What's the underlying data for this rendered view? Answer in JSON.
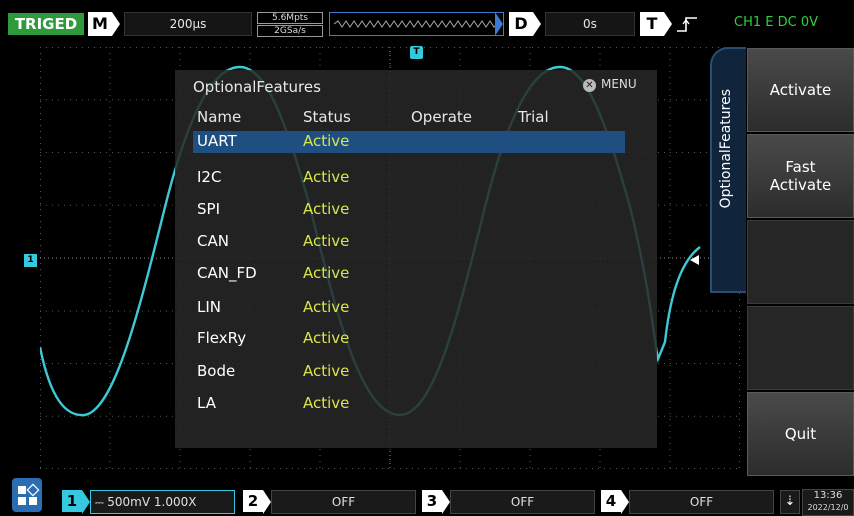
{
  "topbar": {
    "trigger_status": "TRIGED",
    "mode_key": "M",
    "timebase": "200µs",
    "memory_depth": "5.6Mpts",
    "sample_rate": "2GSa/s",
    "delay_key": "D",
    "delay_value": "0s",
    "trigger_key": "T",
    "trigger_info": "CH1 E DC 0V"
  },
  "markers": {
    "trigger_top": "T",
    "ch1_level": "1"
  },
  "dialog": {
    "title": "OptionalFeatures",
    "close_label": "MENU",
    "columns": [
      "Name",
      "Status",
      "Operate",
      "Trial"
    ],
    "rows": [
      {
        "name": "UART",
        "status": "Active"
      },
      {
        "name": "I2C",
        "status": "Active"
      },
      {
        "name": "SPI",
        "status": "Active"
      },
      {
        "name": "CAN",
        "status": "Active"
      },
      {
        "name": "CAN_FD",
        "status": "Active"
      },
      {
        "name": "LIN",
        "status": "Active"
      },
      {
        "name": "FlexRy",
        "status": "Active"
      },
      {
        "name": "Bode",
        "status": "Active"
      },
      {
        "name": "LA",
        "status": "Active"
      }
    ]
  },
  "sidemenu": {
    "tab_label": "OptionalFeatures",
    "activate": "Activate",
    "fast_activate_1": "Fast",
    "fast_activate_2": "Activate",
    "quit": "Quit"
  },
  "bottombar": {
    "ch1": {
      "num": "1",
      "value": "500mV 1.000X"
    },
    "ch2": {
      "num": "2",
      "value": "OFF"
    },
    "ch3": {
      "num": "3",
      "value": "OFF"
    },
    "ch4": {
      "num": "4",
      "value": "OFF"
    },
    "time": "13:36",
    "date": "2022/12/0"
  },
  "colors": {
    "trace": "#3ec9d6",
    "trigger_status": "#2f9a3c",
    "status_active": "#d9e64a",
    "selected_row": "#1f4f80",
    "ch1": "#35c9e0"
  }
}
